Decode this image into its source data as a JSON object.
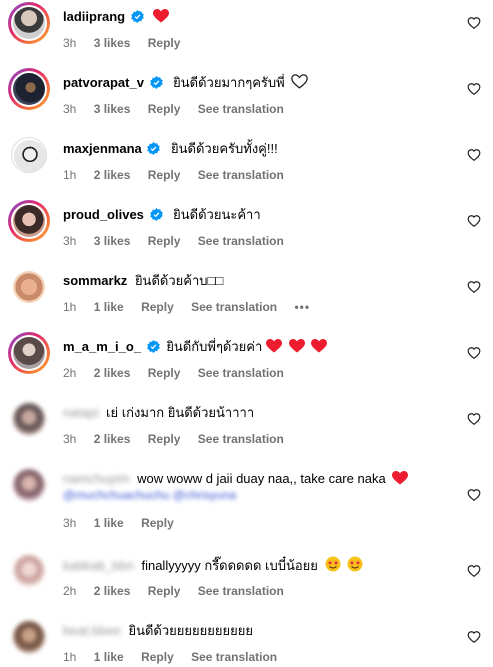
{
  "colors": {
    "muted": "#737373",
    "red_heart": "#ed1c2e",
    "verified": "#0095f6"
  },
  "comments": [
    {
      "username": "ladiiprang",
      "verified": true,
      "text": "",
      "emoji": "red-heart",
      "time": "3h",
      "likes": "3 likes",
      "reply": "Reply",
      "see_translation": ""
    },
    {
      "username": "patvorapat_v",
      "verified": true,
      "text": "ยินดีด้วยมากๆครับพี่",
      "emoji": "white-heart",
      "time": "3h",
      "likes": "3 likes",
      "reply": "Reply",
      "see_translation": "See translation"
    },
    {
      "username": "maxjenmana",
      "verified": true,
      "text": "ยินดีด้วยครับทั้งคู่!!!",
      "emoji": "",
      "time": "1h",
      "likes": "2 likes",
      "reply": "Reply",
      "see_translation": "See translation"
    },
    {
      "username": "proud_olives",
      "verified": true,
      "text": "ยินดีด้วยนะค้าา",
      "emoji": "",
      "time": "3h",
      "likes": "3 likes",
      "reply": "Reply",
      "see_translation": "See translation"
    },
    {
      "username": "sommarkz",
      "verified": false,
      "text": "ยินดีด้วยค้าบ□□",
      "emoji": "",
      "time": "1h",
      "likes": "1 like",
      "reply": "Reply",
      "see_translation": "See translation",
      "more": "•••"
    },
    {
      "username": "m_a_m_i_o_",
      "verified": true,
      "text": "ยินดีกับพี่ๆด้วยค่า",
      "emoji": "three-red-hearts",
      "time": "2h",
      "likes": "2 likes",
      "reply": "Reply",
      "see_translation": "See translation"
    },
    {
      "username": "natapi",
      "verified": false,
      "text": "เย่ เก่งมาก ยินดีด้วยน้าาาา",
      "emoji": "",
      "time": "3h",
      "likes": "2 likes",
      "reply": "Reply",
      "see_translation": "See translation"
    },
    {
      "username": "namchuyim",
      "verified": false,
      "text": "wow woww d jaii duay naa,, take care naka",
      "emoji": "red-heart",
      "time": "3h",
      "likes": "1 like",
      "reply": "Reply",
      "see_translation": "",
      "sub": "@muchchuachuchu @chrisyuna"
    },
    {
      "username": "kabkab_bbn",
      "verified": false,
      "text": "finallyyyyy กรี๊ดดดดด เบบี๋น้อยย",
      "emoji": "star-eyes",
      "time": "2h",
      "likes": "2 likes",
      "reply": "Reply",
      "see_translation": "See translation"
    },
    {
      "username": "beat.bbee",
      "verified": false,
      "text": "ยินดีด้วยยยยยยยยยยย",
      "emoji": "",
      "time": "1h",
      "likes": "1 like",
      "reply": "Reply",
      "see_translation": "See translation"
    }
  ]
}
